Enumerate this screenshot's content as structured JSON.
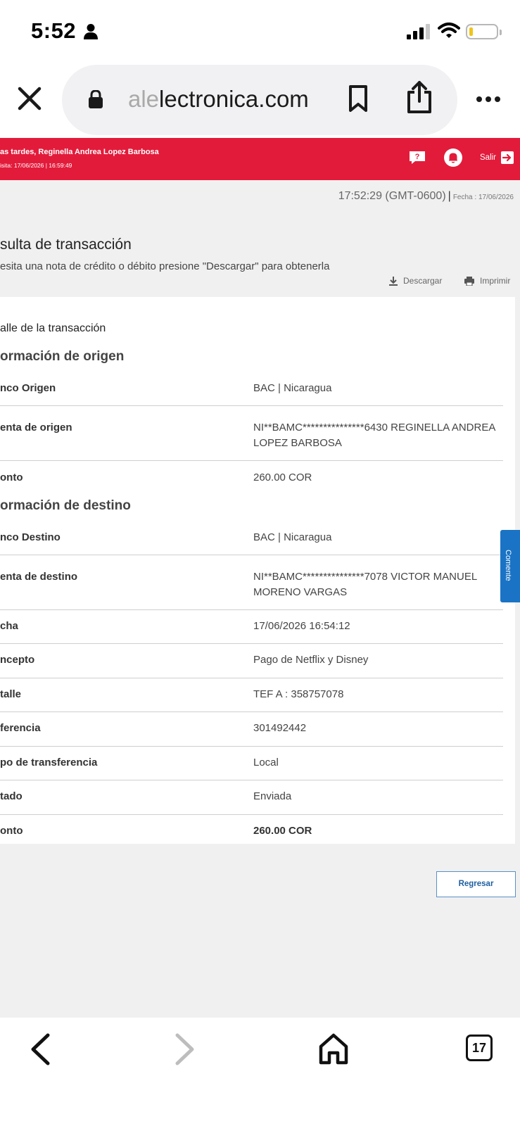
{
  "status_bar": {
    "time": "5:52"
  },
  "browser": {
    "url_faded": "ale",
    "url_main": "lectronica.com"
  },
  "site_header": {
    "greeting": "as tardes, Reginella Andrea Lopez Barbosa",
    "last_visit": "isita:  17/06/2026 | 16:59:49",
    "exit_label": "Salir",
    "brand_color": "#e31b3b"
  },
  "clock": {
    "time": "17:52:29 (GMT-0600)",
    "separator": "|",
    "date": "Fecha :  17/06/2026"
  },
  "page": {
    "title": "sulta de transacción",
    "subtitle": "esita una nota de crédito o débito presione \"Descargar\" para obtenerla",
    "download_label": "Descargar",
    "print_label": "Imprimir"
  },
  "detail": {
    "title": "alle de la transacción",
    "origin_section": "ormación de origen",
    "destination_section": "ormación de destino",
    "origin_rows": [
      {
        "label": "nco Origen",
        "value": "BAC | Nicaragua"
      },
      {
        "label": "enta de origen",
        "value": "NI**BAMC***************6430    REGINELLA ANDREA LOPEZ BARBOSA"
      },
      {
        "label": "onto",
        "value": "260.00    COR"
      }
    ],
    "destination_rows": [
      {
        "label": "nco Destino",
        "value": "BAC | Nicaragua"
      },
      {
        "label": "enta de destino",
        "value": "NI**BAMC***************7078    VICTOR MANUEL MORENO VARGAS"
      },
      {
        "label": "cha",
        "value": "17/06/2026   16:54:12"
      },
      {
        "label": "ncepto",
        "value": "Pago de Netflix y Disney"
      },
      {
        "label": "talle",
        "value": "TEF A : 358757078"
      },
      {
        "label": "ferencia",
        "value": "301492442"
      },
      {
        "label": "po de transferencia",
        "value": "Local"
      },
      {
        "label": "tado",
        "value": "Enviada"
      },
      {
        "label": "onto",
        "value": "260.00    COR"
      }
    ]
  },
  "feedback_tab": "Comente",
  "back_button": "Regresar",
  "toolbar": {
    "tabs_count": "17"
  }
}
